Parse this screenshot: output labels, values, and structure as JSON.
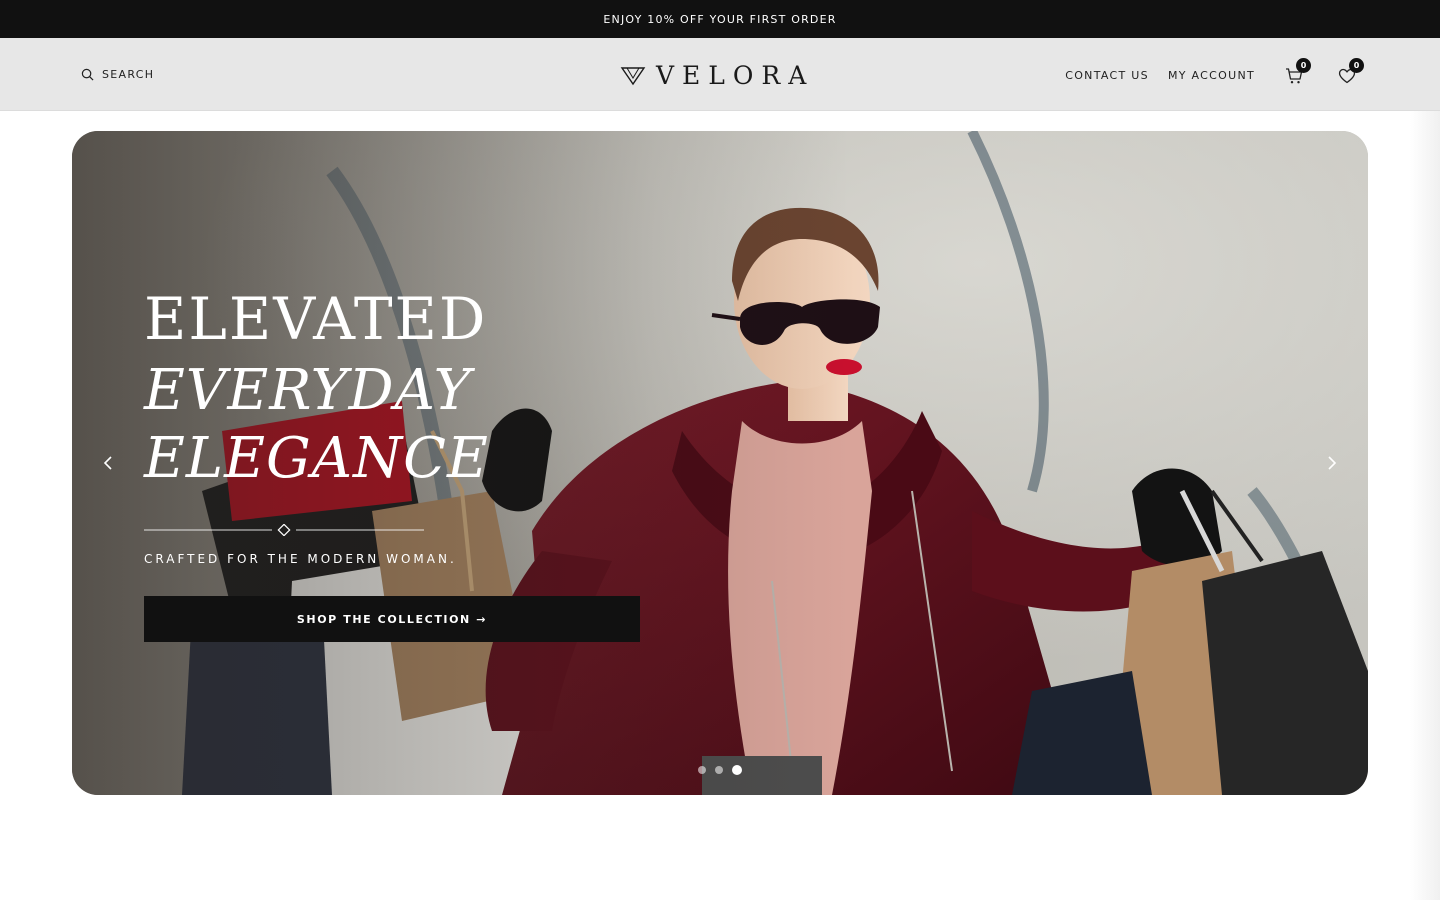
{
  "promo": {
    "text": "ENJOY 10% OFF YOUR FIRST ORDER"
  },
  "header": {
    "search_label": "SEARCH",
    "logo_text": "VELORA",
    "contact_label": "CONTACT US",
    "account_label": "MY ACCOUNT",
    "cart_count": "0",
    "wishlist_count": "0"
  },
  "hero": {
    "headline_line1": "ELEVATED",
    "headline_line2": "EVERYDAY",
    "headline_line3": "ELEGANCE",
    "tagline": "CRAFTED FOR THE MODERN WOMAN.",
    "cta_label": "SHOP THE COLLECTION →",
    "slide_count": 3,
    "active_slide": 3
  },
  "icons": {
    "search": "search-icon",
    "logo": "velora-logo-icon",
    "cart": "cart-icon",
    "wishlist": "heart-icon",
    "prev": "chevron-left-icon",
    "next": "chevron-right-icon"
  },
  "colors": {
    "promo_bg": "#111111",
    "header_bg": "#e7e7e7",
    "cta_bg": "#111111",
    "coat": "#6a1422",
    "lips": "#c8102e"
  }
}
